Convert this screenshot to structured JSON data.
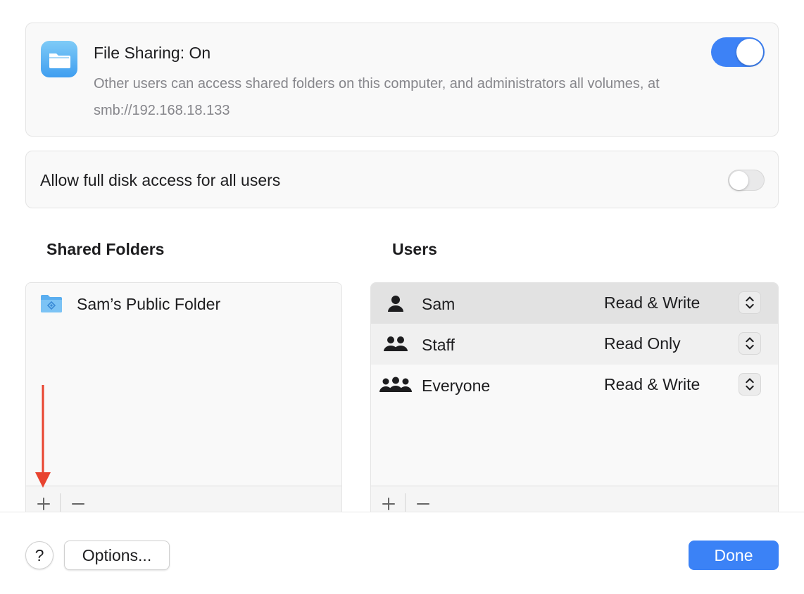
{
  "colors": {
    "accent": "#3b82f6",
    "arrow": "#e8432f",
    "folder_blue": "#5aaef0"
  },
  "file_sharing": {
    "icon": "folder-icon",
    "title": "File Sharing: On",
    "description": "Other users can access shared folders on this computer, and administrators all volumes, at smb://192.168.18.133",
    "enabled": true
  },
  "full_disk_access": {
    "label": "Allow full disk access for all users",
    "enabled": false
  },
  "shared_folders": {
    "heading": "Shared Folders",
    "items": [
      {
        "name": "Sam’s Public Folder",
        "icon": "public-folder-icon"
      }
    ],
    "add_icon": "plus-icon",
    "remove_icon": "minus-icon"
  },
  "users": {
    "heading": "Users",
    "items": [
      {
        "name": "Sam",
        "permission": "Read & Write",
        "icon": "person-icon"
      },
      {
        "name": "Staff",
        "permission": "Read Only",
        "icon": "group-icon"
      },
      {
        "name": "Everyone",
        "permission": "Read & Write",
        "icon": "everyone-icon"
      }
    ],
    "add_icon": "plus-icon",
    "remove_icon": "minus-icon"
  },
  "footer": {
    "help_label": "?",
    "options_label": "Options...",
    "done_label": "Done"
  }
}
